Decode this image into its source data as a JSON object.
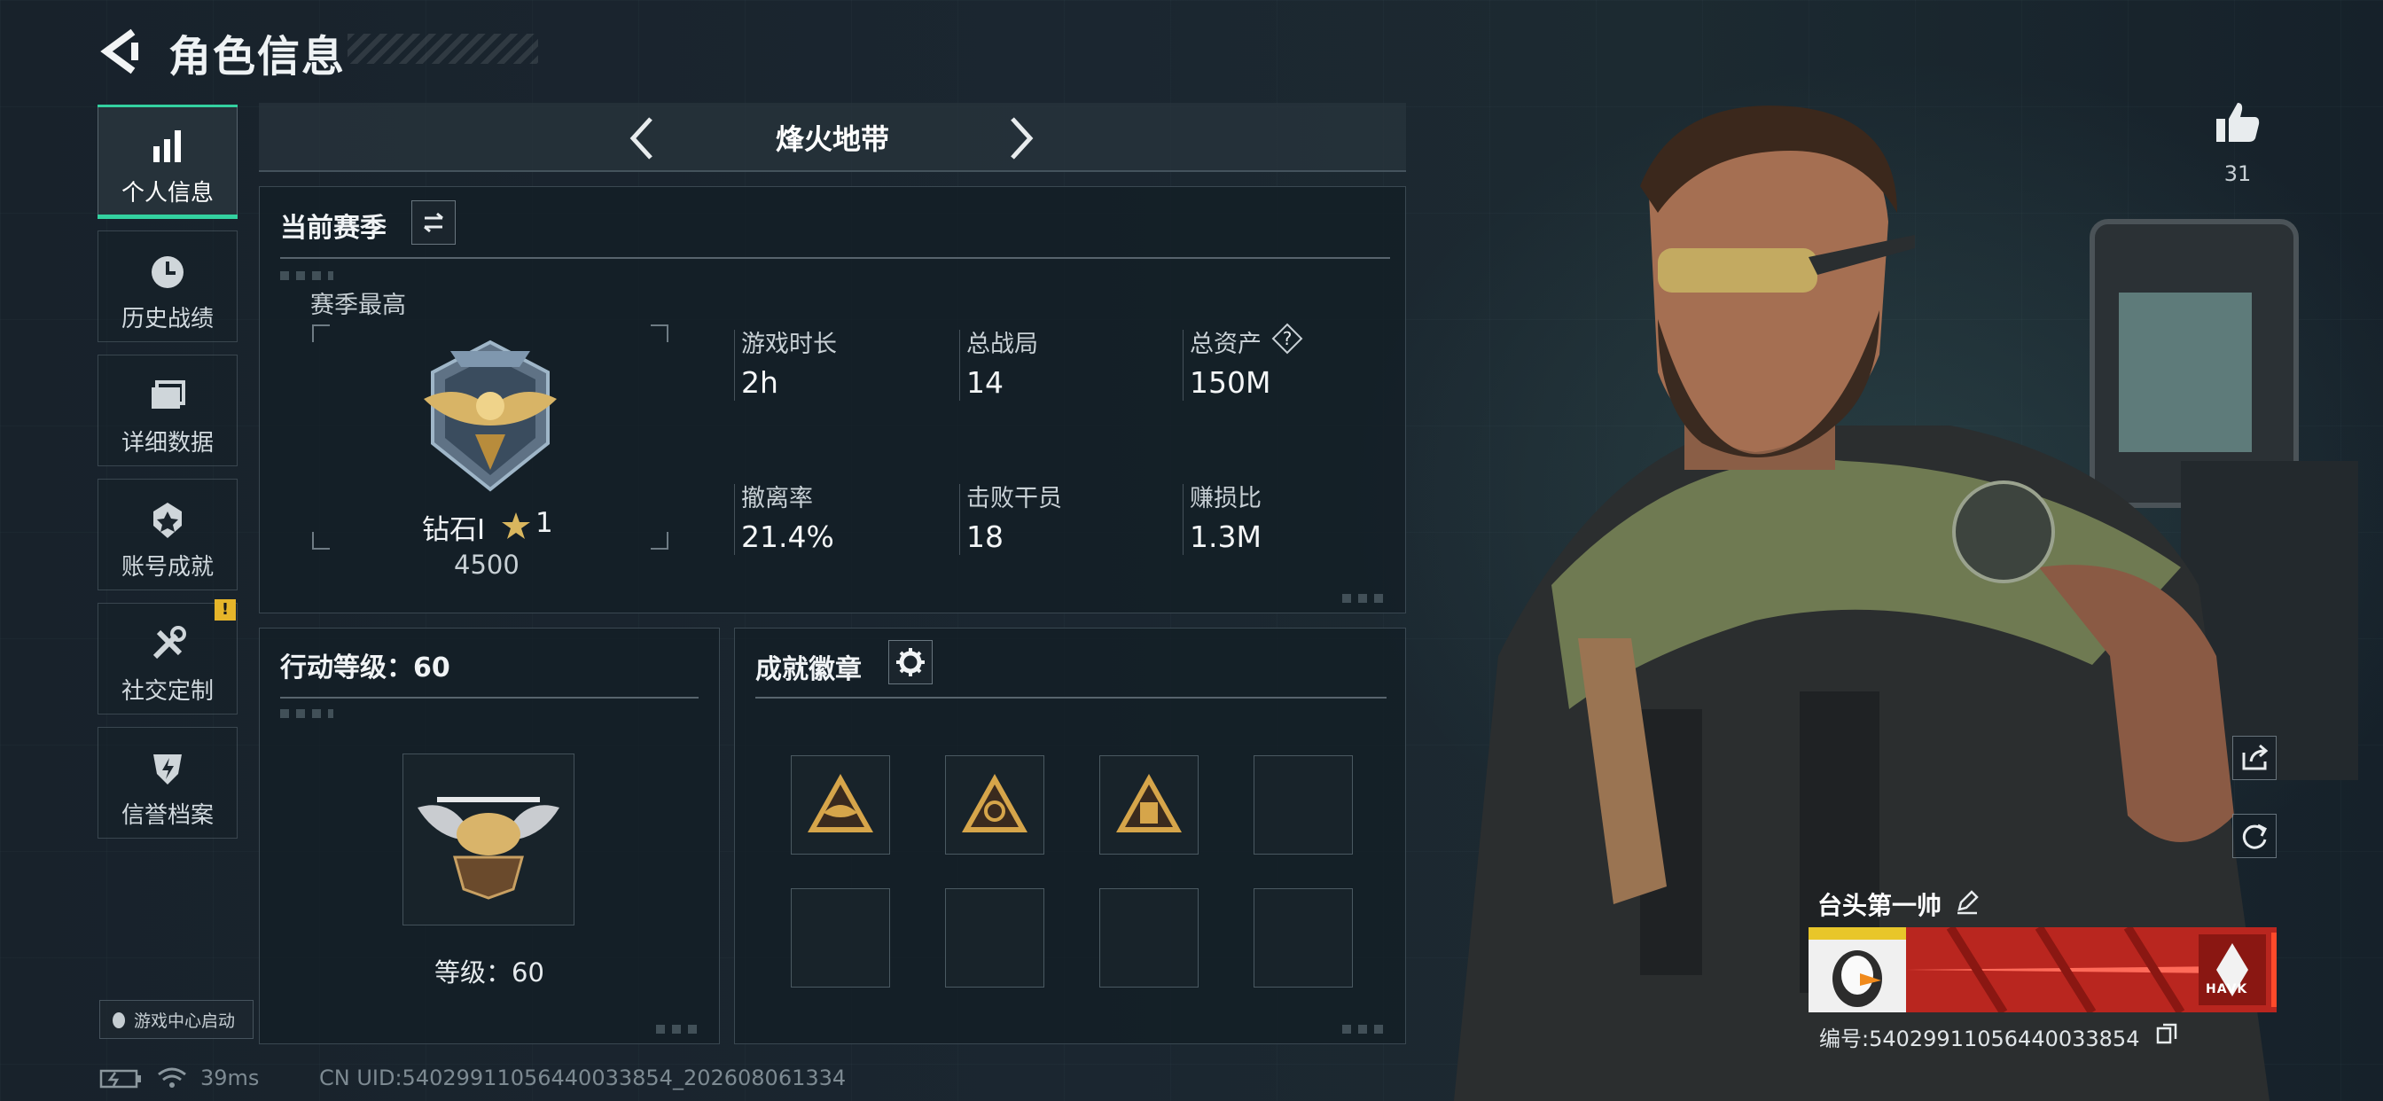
{
  "header": {
    "title": "角色信息"
  },
  "sidebar": {
    "items": [
      {
        "label": "个人信息",
        "icon": "bar-chart-icon",
        "active": true
      },
      {
        "label": "历史战绩",
        "icon": "history-clock-icon"
      },
      {
        "label": "详细数据",
        "icon": "folder-icon"
      },
      {
        "label": "账号成就",
        "icon": "achievement-medal-icon"
      },
      {
        "label": "社交定制",
        "icon": "tools-icon",
        "alert": "!"
      },
      {
        "label": "信誉档案",
        "icon": "credit-shield-icon"
      }
    ],
    "launch_label": "游戏中心启动"
  },
  "mode_bar": {
    "title": "烽火地带"
  },
  "season": {
    "title": "当前赛季",
    "best_label": "赛季最高",
    "rank_name": "钻石Ⅰ",
    "rank_stars": "1",
    "rank_score": "4500",
    "stats": [
      {
        "label": "游戏时长",
        "value": "2h"
      },
      {
        "label": "总战局",
        "value": "14"
      },
      {
        "label": "总资产",
        "value": "150M",
        "help": "?"
      },
      {
        "label": "撤离率",
        "value": "21.4%"
      },
      {
        "label": "击败干员",
        "value": "18"
      },
      {
        "label": "赚损比",
        "value": "1.3M"
      }
    ]
  },
  "action_level": {
    "title": "行动等级：60",
    "level_text": "等级：60"
  },
  "badges": {
    "title": "成就徽章",
    "filled_count": 3,
    "slot_count": 8
  },
  "profile": {
    "likes": "31",
    "player_name": "台头第一帅",
    "uid_line": "编号:5402991105644003385​4",
    "card_brand": "HAVK"
  },
  "status_bar": {
    "ping": "39ms",
    "uid": "CN UID:5402991105644003385​4_202608061334"
  },
  "colors": {
    "accent": "#33d1a0",
    "warning": "#e6b52a",
    "background": "#172029"
  }
}
